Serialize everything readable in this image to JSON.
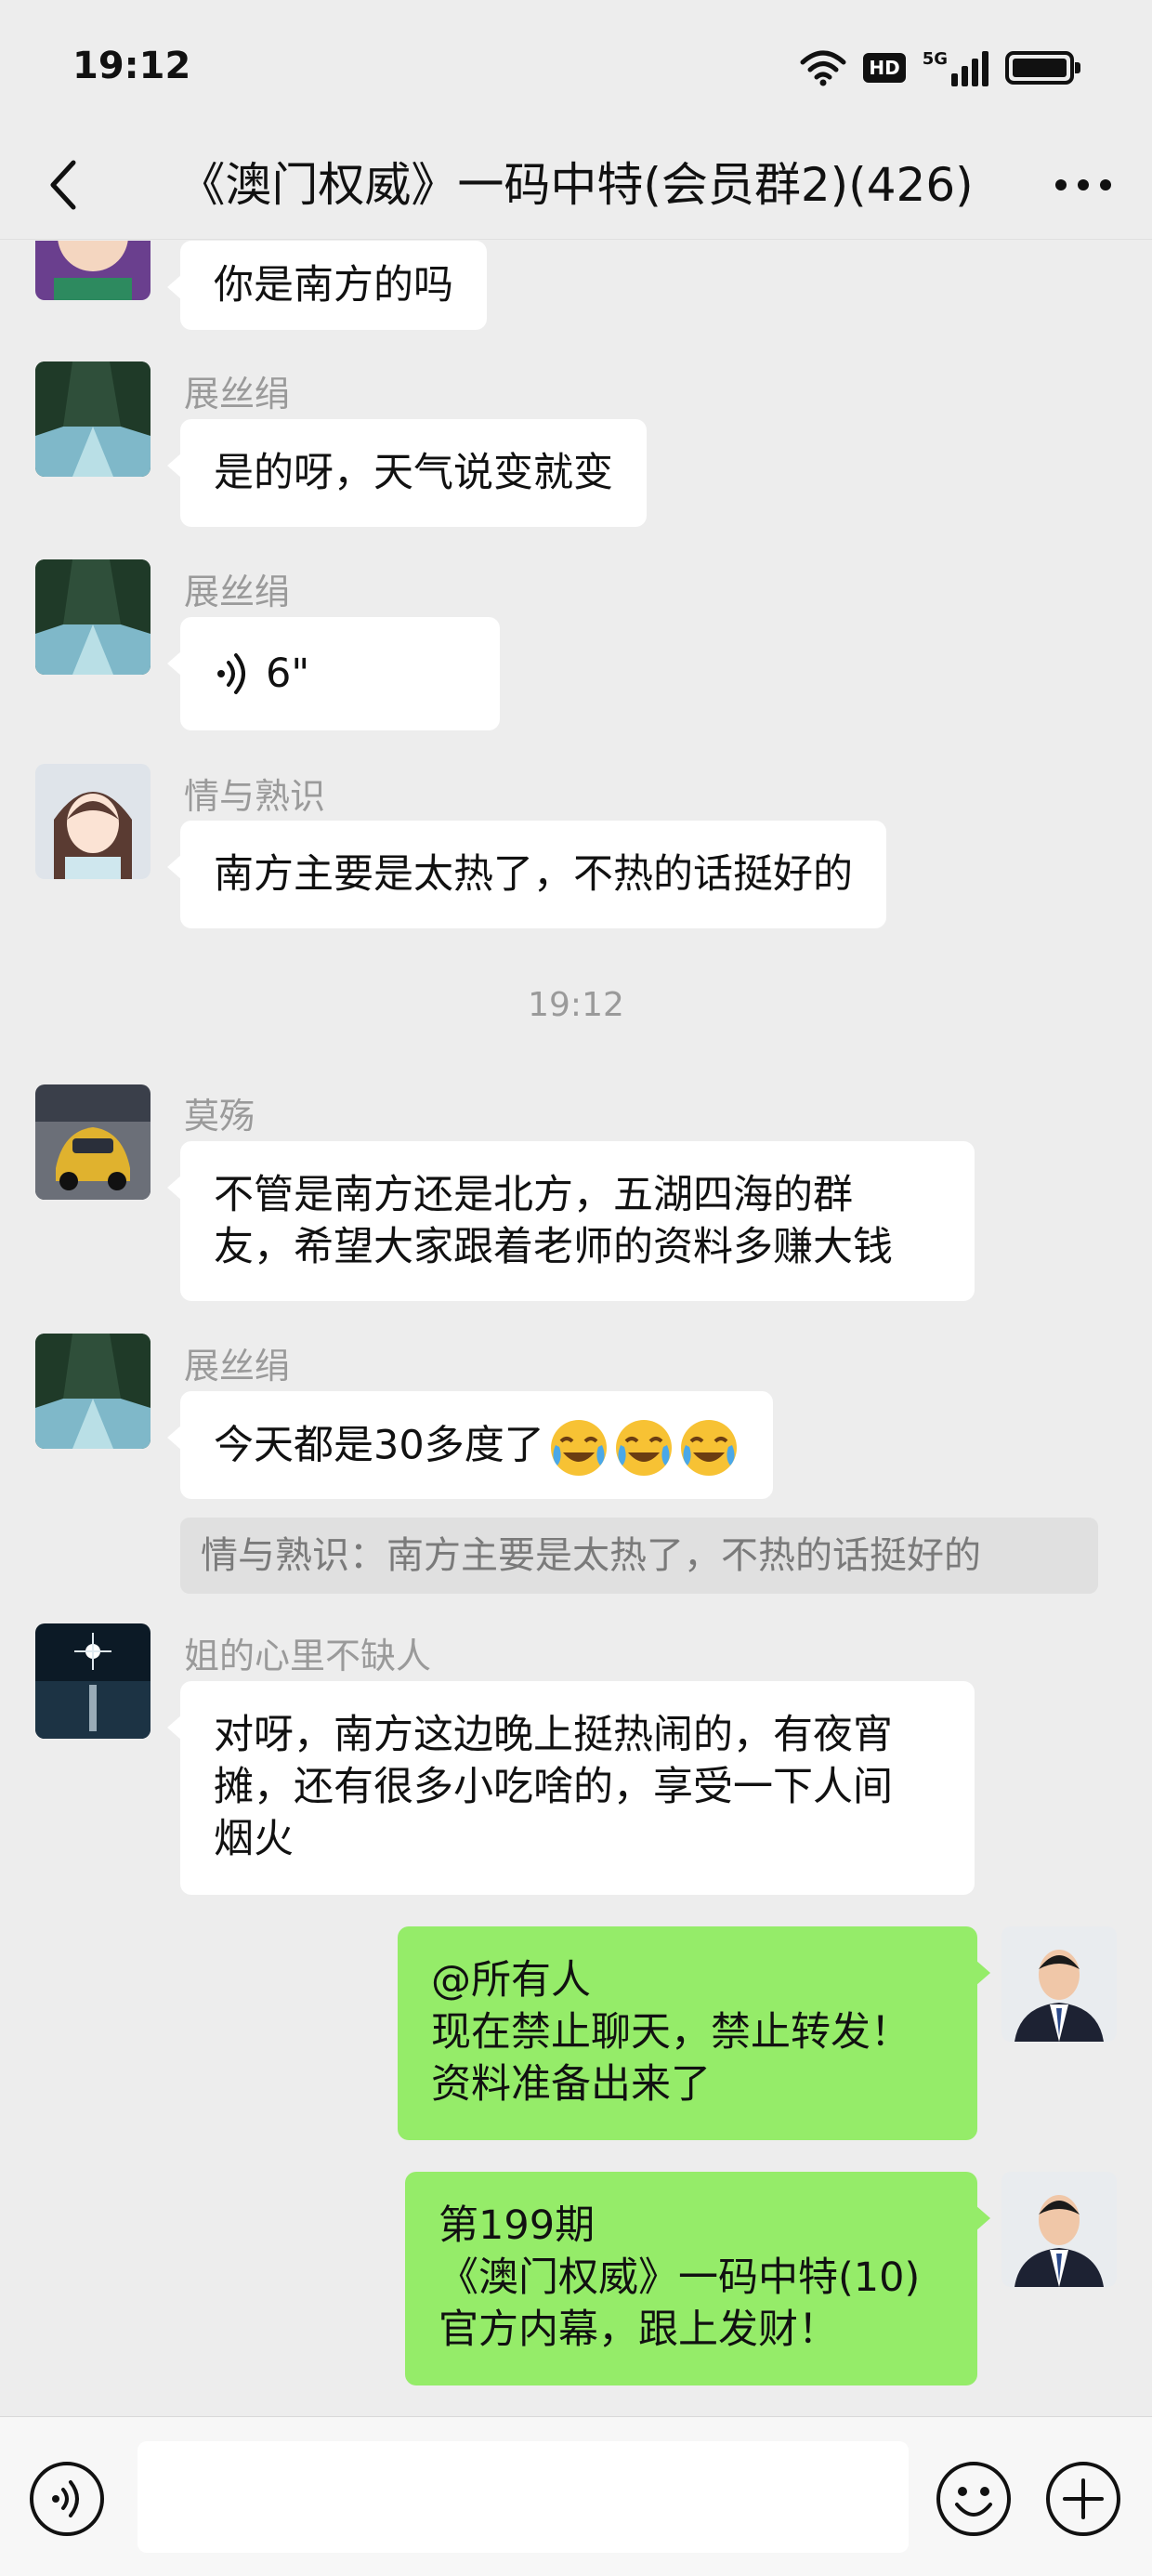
{
  "status_bar": {
    "time": "19:12",
    "hd_label": "HD",
    "network_label": "5G"
  },
  "header": {
    "title": "《澳门权威》一码中特(会员群2)(426)"
  },
  "messages": [
    {
      "text": "你是南方的吗"
    },
    {
      "sender": "展丝绢",
      "text": "是的呀，天气说变就变"
    },
    {
      "sender": "展丝绢",
      "voice_duration": "6\""
    },
    {
      "sender": "情与熟识",
      "text": "南方主要是太热了，不热的话挺好的"
    },
    {
      "timestamp": "19:12"
    },
    {
      "sender": "莫殇",
      "lines": [
        "不管是南方还是北方，五湖四海的群",
        "友，希望大家跟着老师的资料多赚大钱"
      ]
    },
    {
      "sender": "展丝绢",
      "text": "今天都是30多度了",
      "emoji": "face-with-tears-of-joy"
    },
    {
      "quote": "情与熟识：南方主要是太热了，不热的话挺好的"
    },
    {
      "sender": "姐的心里不缺人",
      "lines": [
        "对呀，南方这边晚上挺热闹的，有夜宵",
        "摊，还有很多小吃啥的，享受一下人间",
        "烟火"
      ]
    },
    {
      "self": true,
      "lines": [
        "@所有人",
        "现在禁止聊天，禁止转发！",
        "资料准备出来了"
      ]
    },
    {
      "self": true,
      "lines": [
        "第199期",
        "《澳门权威》一码中特(10)",
        "官方内幕，跟上发财！"
      ]
    }
  ],
  "colors": {
    "background": "#ededed",
    "bubble_other": "#ffffff",
    "bubble_self": "#95ec69",
    "sender_name": "#9a9a9a"
  },
  "icons": {
    "back": "chevron-left-icon",
    "more": "more-dots-icon",
    "voice": "voice-input-icon",
    "emoji": "emoji-icon",
    "plus": "plus-icon"
  }
}
